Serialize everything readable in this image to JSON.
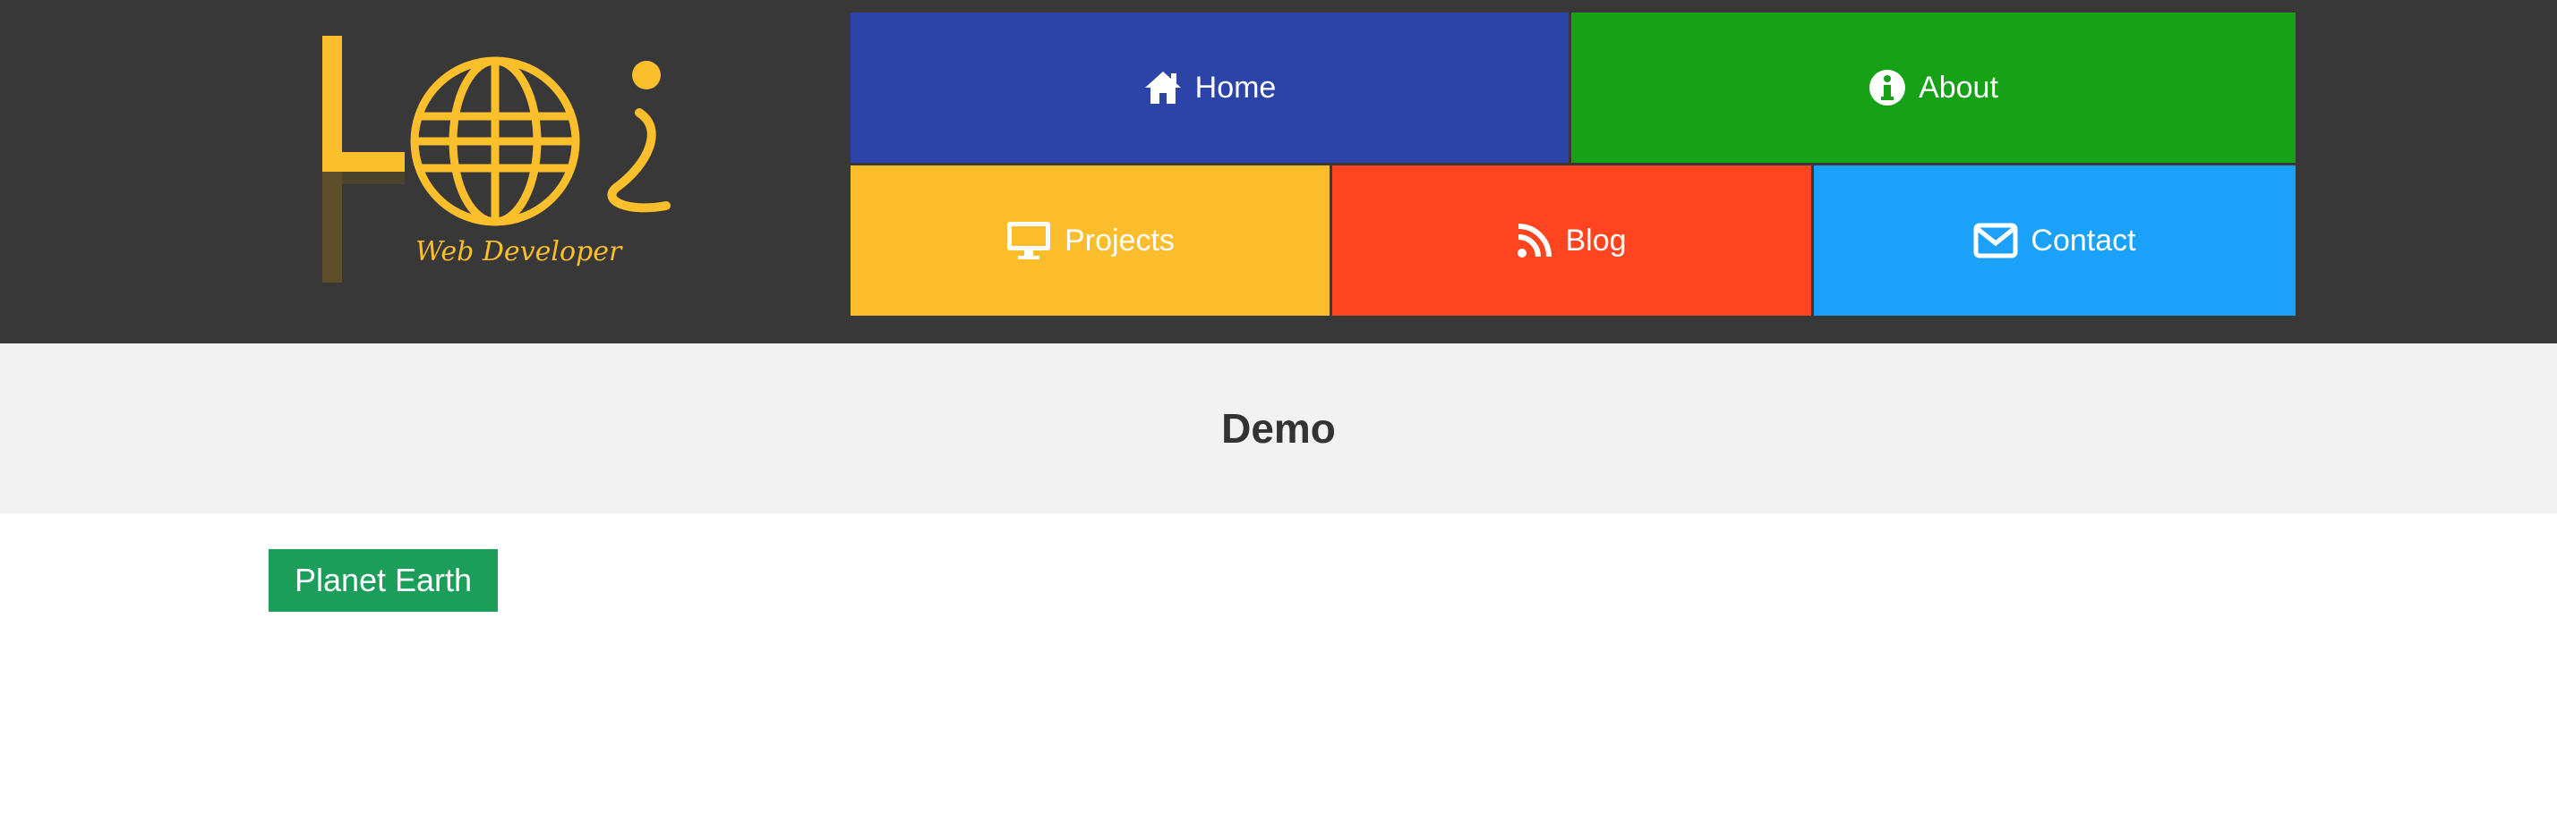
{
  "logo": {
    "caption": "Web Developer",
    "color": "#FBBF2C"
  },
  "nav": {
    "items": [
      {
        "label": "Home",
        "icon": "home-icon",
        "color": "#2C44A8"
      },
      {
        "label": "About",
        "icon": "info-icon",
        "color": "#17A117"
      },
      {
        "label": "Projects",
        "icon": "monitor-icon",
        "color": "#FBBD2C"
      },
      {
        "label": "Blog",
        "icon": "rss-icon",
        "color": "#FF441F"
      },
      {
        "label": "Contact",
        "icon": "envelope-icon",
        "color": "#1BA1F9"
      }
    ]
  },
  "page": {
    "title": "Demo"
  },
  "tag": {
    "label": "Planet Earth",
    "color": "#1A9E5A"
  },
  "colors": {
    "header_bg": "#383838",
    "band_bg": "#F2F2F2"
  }
}
